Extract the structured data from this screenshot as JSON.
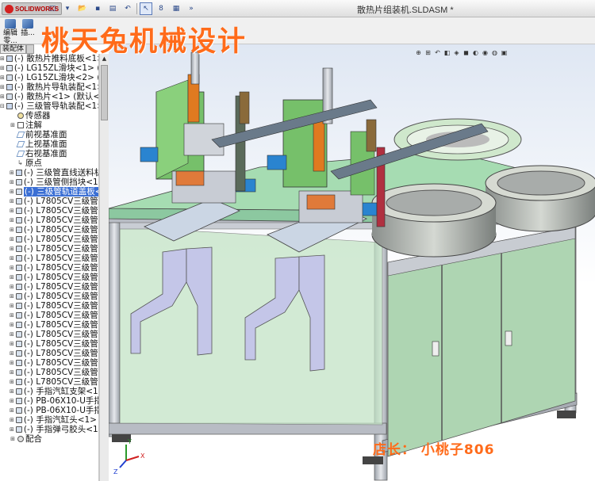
{
  "app": {
    "logo_text": "SOLIDWORKS",
    "document_title": "散热片组装机.SLDASM *"
  },
  "command_bar": {
    "items": [
      {
        "label": "编辑\n零..."
      },
      {
        "label": "插..."
      }
    ]
  },
  "watermark_text": "桃天兔机械设计",
  "feature_manager": {
    "tab_label": "装配体",
    "tree": [
      {
        "label": "(-) 散热片推料底板<1> (",
        "kind": "asm",
        "expand": "+"
      },
      {
        "label": "(-) LG15ZL滑块<1> (默认",
        "kind": "part",
        "expand": "+"
      },
      {
        "label": "(-) LG15ZL滑块<2> (默认",
        "kind": "part",
        "expand": "+"
      },
      {
        "label": "(-) 散热片导轨装配<1> (",
        "kind": "asm",
        "expand": "+"
      },
      {
        "label": "(-) 散热片<1> (默认<<默",
        "kind": "part",
        "expand": "+"
      },
      {
        "label": "(-) 三级管导轨装配<1> (",
        "kind": "asm",
        "expand": "-"
      },
      {
        "label": "传感器",
        "kind": "sensor",
        "expand": "",
        "child": true
      },
      {
        "label": "注解",
        "kind": "note",
        "expand": "+",
        "child": true
      },
      {
        "label": "前视基准面",
        "kind": "plane",
        "expand": "",
        "child": true
      },
      {
        "label": "上视基准面",
        "kind": "plane",
        "expand": "",
        "child": true
      },
      {
        "label": "右视基准面",
        "kind": "plane",
        "expand": "",
        "child": true
      },
      {
        "label": "原点",
        "kind": "origin",
        "expand": "",
        "child": true
      },
      {
        "label": "(-) 三级管直线送料机构",
        "kind": "asm",
        "expand": "+",
        "child": true
      },
      {
        "label": "(-) 三级管侧挡块<1> (",
        "kind": "part",
        "expand": "+",
        "child": true
      },
      {
        "label": "(-) 三级管轨道盖板<1>",
        "kind": "part",
        "expand": "+",
        "child": true,
        "selected": true
      },
      {
        "label": "(-) L7805CV三级管<1>",
        "kind": "part",
        "expand": "+",
        "child": true
      },
      {
        "label": "(-) L7805CV三级管<2>",
        "kind": "part",
        "expand": "+",
        "child": true
      },
      {
        "label": "(-) L7805CV三级管<3>",
        "kind": "part",
        "expand": "+",
        "child": true
      },
      {
        "label": "(-) L7805CV三级管<4>",
        "kind": "part",
        "expand": "+",
        "child": true
      },
      {
        "label": "(-) L7805CV三级管<5>",
        "kind": "part",
        "expand": "+",
        "child": true
      },
      {
        "label": "(-) L7805CV三级管<6>",
        "kind": "part",
        "expand": "+",
        "child": true
      },
      {
        "label": "(-) L7805CV三级管<7>",
        "kind": "part",
        "expand": "+",
        "child": true
      },
      {
        "label": "(-) L7805CV三级管<8>",
        "kind": "part",
        "expand": "+",
        "child": true
      },
      {
        "label": "(-) L7805CV三级管<9>",
        "kind": "part",
        "expand": "+",
        "child": true
      },
      {
        "label": "(-) L7805CV三级管<10",
        "kind": "part",
        "expand": "+",
        "child": true
      },
      {
        "label": "(-) L7805CV三级管<11",
        "kind": "part",
        "expand": "+",
        "child": true
      },
      {
        "label": "(-) L7805CV三级管<12",
        "kind": "part",
        "expand": "+",
        "child": true
      },
      {
        "label": "(-) L7805CV三级管<13",
        "kind": "part",
        "expand": "+",
        "child": true
      },
      {
        "label": "(-) L7805CV三级管<14",
        "kind": "part",
        "expand": "+",
        "child": true
      },
      {
        "label": "(-) L7805CV三级管<15",
        "kind": "part",
        "expand": "+",
        "child": true
      },
      {
        "label": "(-) L7805CV三级管<16",
        "kind": "part",
        "expand": "+",
        "child": true
      },
      {
        "label": "(-) L7805CV三级管<17",
        "kind": "part",
        "expand": "+",
        "child": true
      },
      {
        "label": "(-) L7805CV三级管<18",
        "kind": "part",
        "expand": "+",
        "child": true
      },
      {
        "label": "(-) L7805CV三级管<19",
        "kind": "part",
        "expand": "+",
        "child": true
      },
      {
        "label": "(-) L7805CV三级管<20",
        "kind": "part",
        "expand": "+",
        "child": true
      },
      {
        "label": "(-) 手指汽缸支架<1> (",
        "kind": "part",
        "expand": "+",
        "child": true
      },
      {
        "label": "(-) PB-06X10-U手指汽",
        "kind": "part",
        "expand": "+",
        "child": true
      },
      {
        "label": "(-) PB-06X10-U手指汽",
        "kind": "part",
        "expand": "+",
        "child": true
      },
      {
        "label": "(-) 手指汽缸头<1> (默认",
        "kind": "part",
        "expand": "+",
        "child": true
      },
      {
        "label": "(-) 手指弹弓胶头<1> (",
        "kind": "part",
        "expand": "+",
        "child": true
      },
      {
        "label": "配合",
        "kind": "mate",
        "expand": "+",
        "child": true
      }
    ]
  },
  "triad": {
    "x_label": "X",
    "y_label": "Y",
    "z_label": "Z"
  },
  "shop_caption": "店长： 小桃子806",
  "colors": {
    "table_green": "#9ed3a6",
    "frame_gray": "#b8bcc4",
    "bracket_lavender": "#c4c6e8",
    "watermark_orange": "#ff6b1a",
    "selection_blue": "#3b6fd4"
  }
}
